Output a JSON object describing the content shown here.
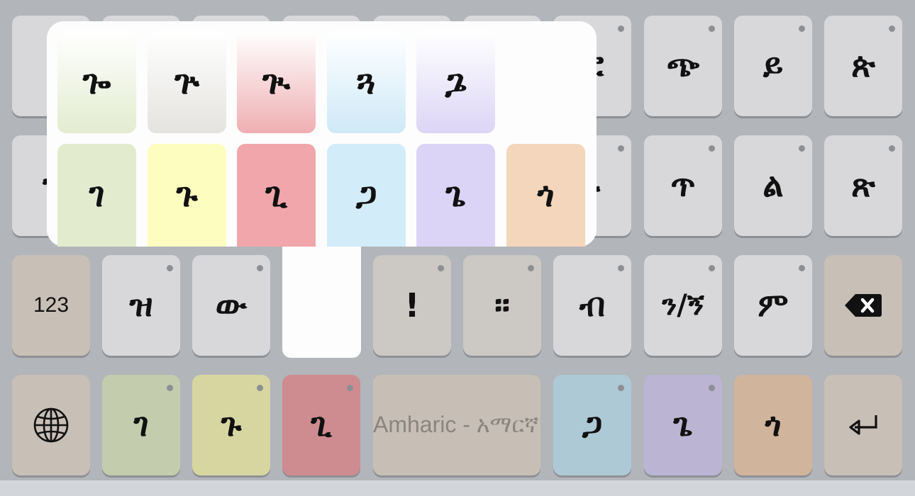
{
  "keyboard": {
    "row1": [
      "",
      "",
      "",
      "",
      "",
      "",
      "ፎ",
      "ጭ",
      "ይ",
      "ጵ"
    ],
    "row2": [
      "ን",
      "",
      "",
      "",
      "",
      "",
      "ኑ",
      "ጥ",
      "ል",
      "ጽ"
    ],
    "row3": {
      "numbers_label": "123",
      "keys": [
        "ዝ",
        "ው",
        "",
        "!",
        "።",
        "ብ",
        "ን/ኝ",
        "ም"
      ]
    },
    "row4": {
      "g1": "ገ",
      "g2": "ጉ",
      "g3": "ጊ",
      "space_label": "Amharic - አማርኛ",
      "g4": "ጋ",
      "g5": "ጌ",
      "g6": "ጎ"
    }
  },
  "popup": {
    "row_top": [
      "ጐ",
      "ጕ",
      "ጒ",
      "ጓ",
      "ጔ"
    ],
    "row_bottom": [
      "ገ",
      "ጉ",
      "ጊ",
      "ጋ",
      "ጌ",
      "ጎ"
    ]
  },
  "icons": {
    "globe": "globe-icon",
    "backspace": "backspace-icon",
    "return": "return-icon"
  },
  "colors": {
    "background": "#b2b5b9",
    "key": "#d8d8da",
    "function_key": "#c8bfb6",
    "popup": "#fdfdfd"
  }
}
